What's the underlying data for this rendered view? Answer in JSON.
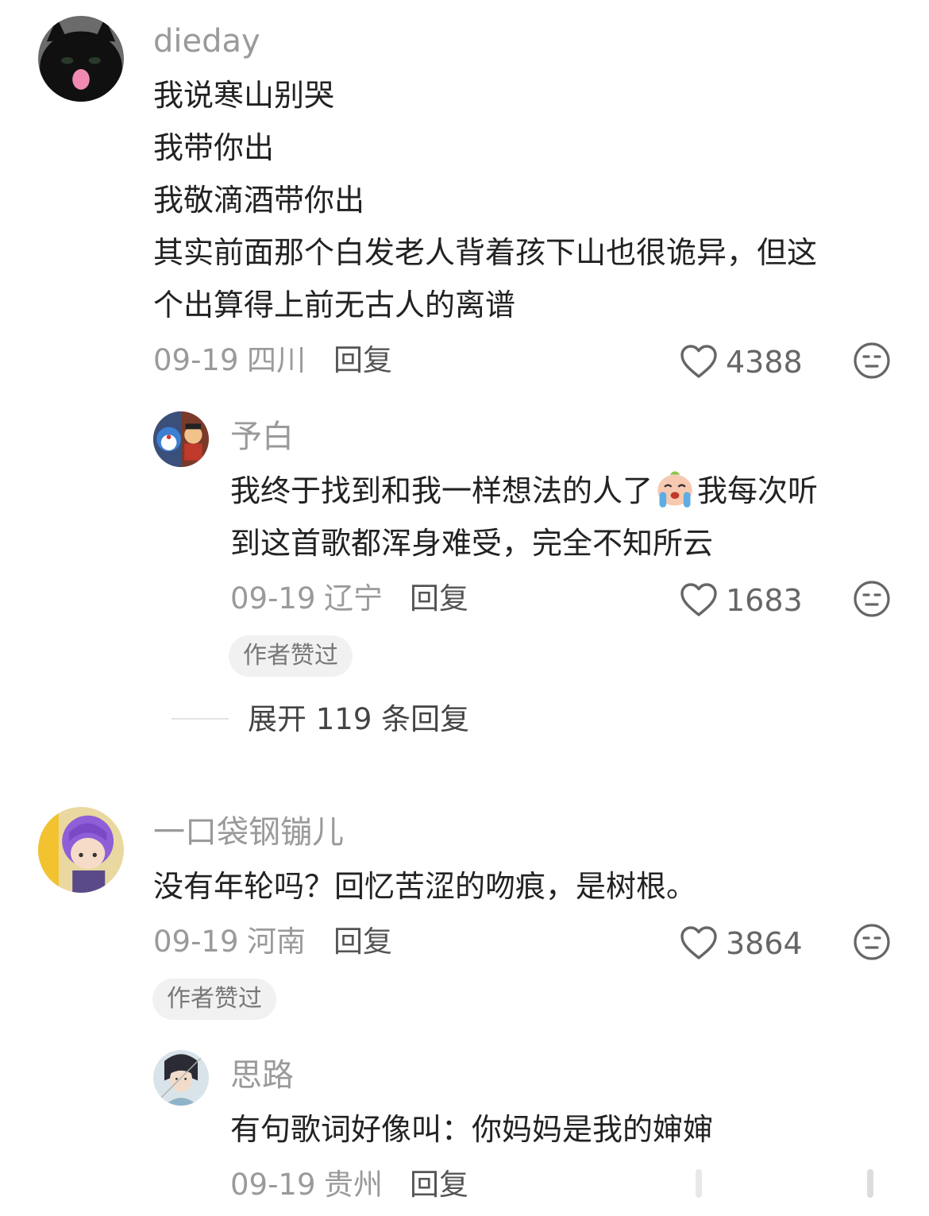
{
  "comments": [
    {
      "username": "dieday",
      "lines": [
        "我说寒山别哭",
        "我带你出",
        "我敬滴酒带你出",
        "其实前面那个白发老人背着孩下山也很诡异，但这",
        "个出算得上前无古人的离谱"
      ],
      "date": "09-19",
      "region": "四川",
      "reply_label": "回复",
      "likes": "4388",
      "avatar_icon": "black-cat-avatar"
    },
    {
      "username": "一口袋钢镚儿",
      "lines": [
        "没有年轮吗？回忆苦涩的吻痕，是树根。"
      ],
      "date": "09-19",
      "region": "河南",
      "reply_label": "回复",
      "likes": "3864",
      "author_badge": "作者赞过",
      "avatar_icon": "purple-hair-anime-avatar"
    }
  ],
  "replies": [
    {
      "username": "予白",
      "line1_before": "我终于找到和我一样想法的人了",
      "line1_after": "我每次听",
      "line2": "到这首歌都浑身难受，完全不知所云",
      "emoji": "crying-face-emoji",
      "date": "09-19",
      "region": "辽宁",
      "reply_label": "回复",
      "likes": "1683",
      "author_badge": "作者赞过",
      "avatar_icon": "cartoon-collage-avatar"
    },
    {
      "username": "思路",
      "line1": "有句歌词好像叫：你妈妈是我的婶婶",
      "date": "09-19",
      "region": "贵州",
      "reply_label": "回复",
      "avatar_icon": "swordsman-avatar"
    }
  ],
  "expand_replies_label": "展开 119 条回复",
  "colors": {
    "username": "#9a9a9a",
    "text": "#222222",
    "meta": "#9a9a9a",
    "badge_bg": "#f1f1f1"
  }
}
